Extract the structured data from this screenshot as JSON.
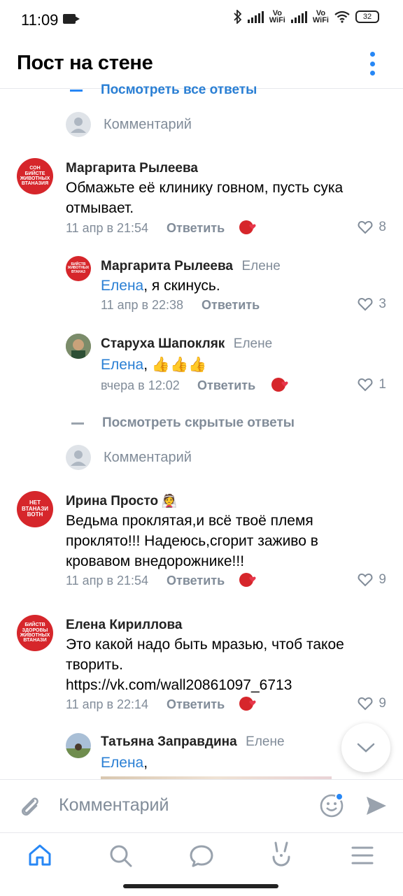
{
  "status_bar": {
    "time": "11:09",
    "battery": "32",
    "volte1": "Vo\nWiFi",
    "volte2": "Vo\nWiFi"
  },
  "header": {
    "title": "Пост на стене"
  },
  "thread": {
    "view_all_replies": "Посмотреть все ответы",
    "comment_placeholder": "Комментарий"
  },
  "comments": [
    {
      "name": "Маргарита Рылеева",
      "avatar_text": [
        "СОН",
        "БИЙСТЕ",
        "ЖИВОТНЫХ",
        "ВТАНАЗИЯ"
      ],
      "text": "Обмажьте её клинику говном, пусть сука отмывает.",
      "date": "11 апр в 21:54",
      "reply": "Ответить",
      "likes": "8"
    },
    {
      "name": "Маргарита Рылеева",
      "to": "Елене",
      "mention": "Елена",
      "text": ", я скинусь.",
      "date": "11 апр в 22:38",
      "reply": "Ответить",
      "likes": "3"
    },
    {
      "name": "Старуха Шапокляк",
      "to": "Елене",
      "mention": "Елена",
      "text": ", 👍👍👍",
      "date": "вчера в 12:02",
      "reply": "Ответить",
      "likes": "1"
    },
    {
      "name": "Ирина Просто",
      "avatar_text": [
        "НЕТ",
        "ВТАНАЗИ",
        "ВОТН"
      ],
      "text": "Ведьма проклятая,и всё твоё племя проклято!!! Надеюсь,сгорит заживо в кровавом внедорожнике!!!",
      "date": "11 апр в 21:54",
      "reply": "Ответить",
      "likes": "9"
    },
    {
      "name": "Елена Кириллова",
      "avatar_text": [
        "БИЙСТВ",
        "ЗДОРОВЫ",
        "ЖИВОТНЫХ",
        "ВТАНАЗИ"
      ],
      "text": "Это какой надо быть мразью, чтоб такое творить.",
      "link": "https://vk.com/wall20861097_6713",
      "date": "11 апр в 22:14",
      "reply": "Ответить",
      "likes": "9"
    },
    {
      "name": "Татьяна Заправдина",
      "to": "Елене",
      "mention": "Елена",
      "text": ","
    }
  ],
  "hidden_replies": "Посмотреть скрытые ответы",
  "composer": {
    "placeholder": "Комментарий"
  },
  "nav": {
    "items": [
      "home-icon",
      "search-icon",
      "messages-icon",
      "clips-icon",
      "menu-icon"
    ]
  },
  "colors": {
    "accent": "#2787f5",
    "brand_red": "#d6262b",
    "muted": "#818c99"
  }
}
